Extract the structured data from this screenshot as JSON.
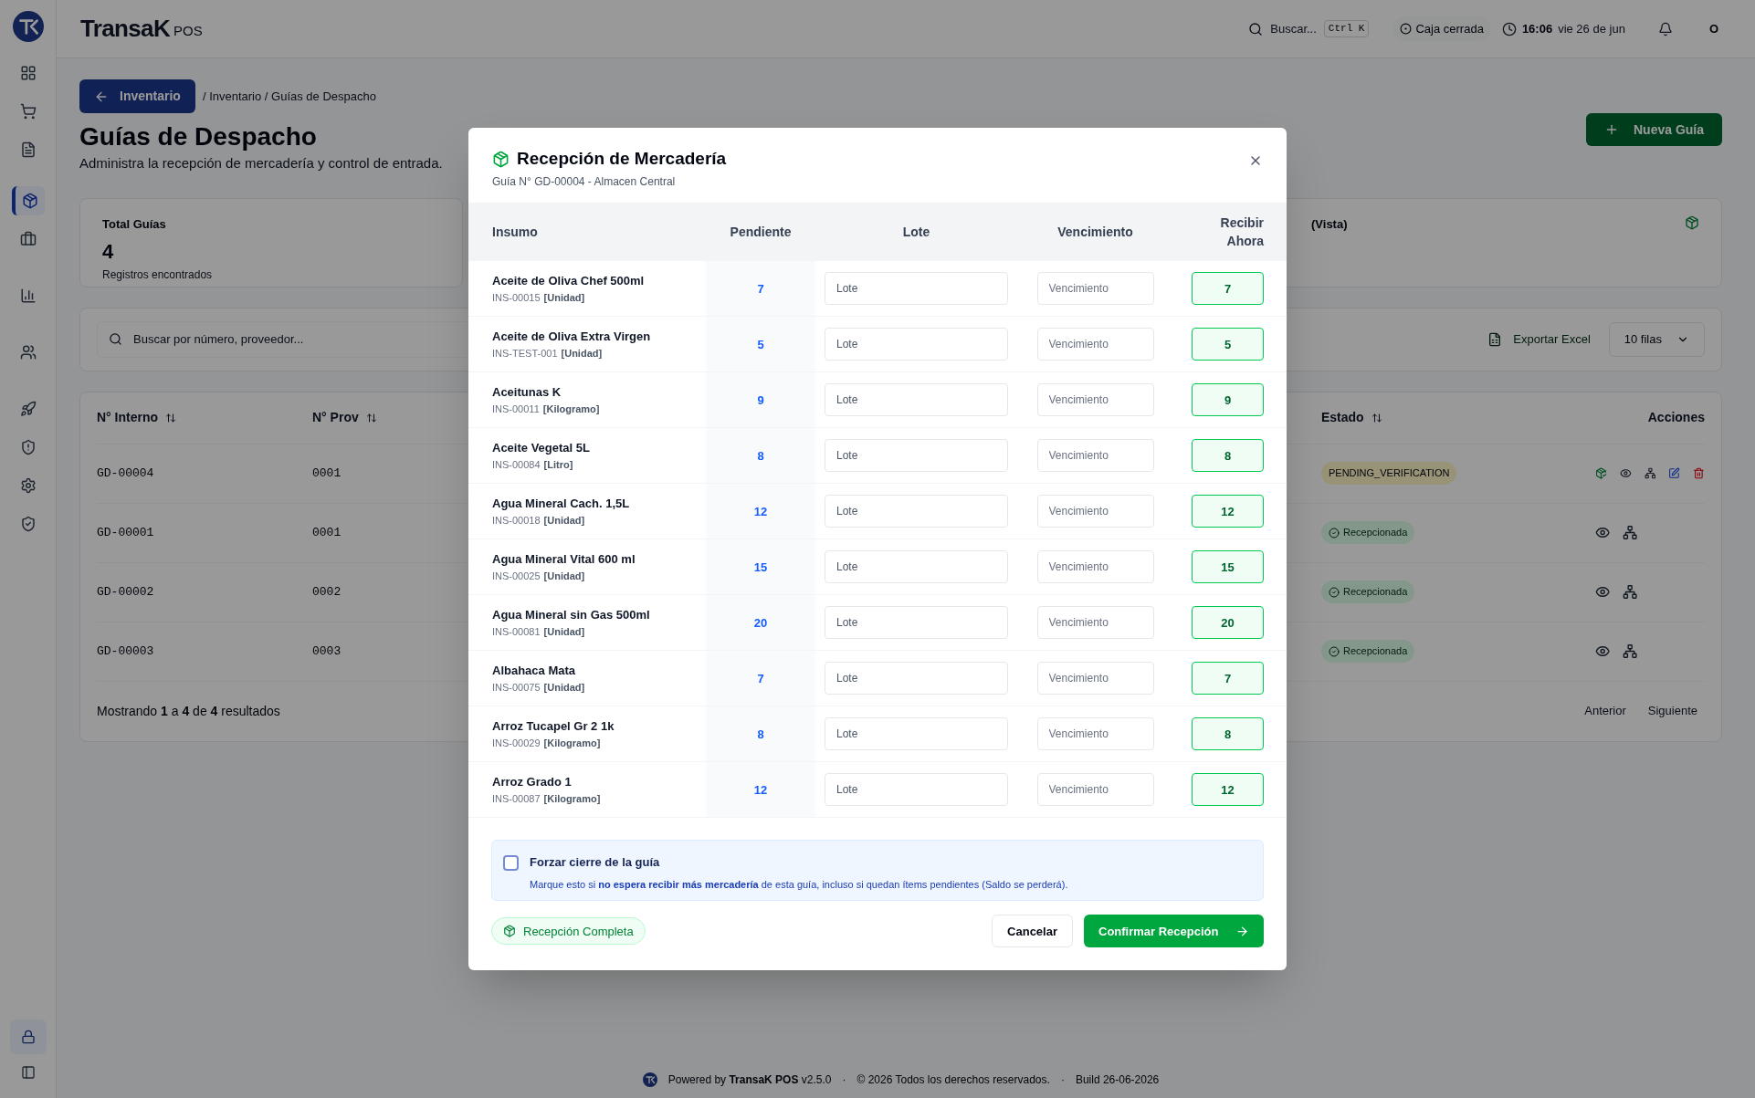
{
  "topbar": {
    "brand": "TransaK",
    "brand_suffix": "POS",
    "search": "Buscar...",
    "shortcut": "Ctrl K",
    "cash_status": "Caja cerrada",
    "time": "16:06",
    "date": "vie 26 de jun",
    "avatar": "O"
  },
  "sidebar": {
    "items": [
      {
        "selected": false
      },
      {
        "selected": false
      },
      {
        "selected": false
      },
      {
        "selected": true
      },
      {
        "selected": false
      },
      {
        "selected": false
      },
      {
        "selected": false
      },
      {
        "selected": false
      },
      {
        "selected": false
      },
      {
        "selected": false
      },
      {
        "selected": false
      }
    ]
  },
  "page": {
    "back_button": "Inventario",
    "breadcrumb": "/ Inventario / Guías de Despacho",
    "title": "Guías de Despacho",
    "subtitle": "Administra la recepción de mercadería y control de entrada.",
    "new_button": "Nueva Guía",
    "stats": [
      {
        "label": "Total Guías",
        "value": "4",
        "caption": "Registros encontrados"
      },
      {
        "label": "(Vista)"
      }
    ],
    "search_placeholder": "Buscar por número, proveedor...",
    "export_button": "Exportar Excel",
    "rows_select": "10 filas",
    "columns": [
      "N° Interno",
      "N° Prov",
      "Estado",
      "Acciones"
    ],
    "rows": [
      {
        "id": "GD-00004",
        "prov": "0001",
        "status": "PENDING_VERIFICATION",
        "kind": "pending"
      },
      {
        "id": "GD-00001",
        "prov": "0001",
        "status": "Recepcionada",
        "kind": "received"
      },
      {
        "id": "GD-00002",
        "prov": "0002",
        "status": "Recepcionada",
        "kind": "received"
      },
      {
        "id": "GD-00003",
        "prov": "0003",
        "status": "Recepcionada",
        "kind": "received"
      }
    ],
    "pagination_text": "Mostrando **1** a **4** de **4** resultados",
    "prev": "Anterior",
    "next": "Siguiente"
  },
  "footer": {
    "powered": "Powered by **TransaK POS** v2.5.0",
    "sep1": "·",
    "copyright": "© 2026 Todos los derechos reservados.",
    "sep2": "·",
    "build": "Build 26-06-2026"
  },
  "modal": {
    "title": "Recepción de Mercadería",
    "subtitle": "Guía N° GD-00004 - Almacen Central",
    "columns": [
      "Insumo",
      "Pendiente",
      "Lote",
      "Vencimiento",
      "Recibir Ahora"
    ],
    "items": [
      {
        "name": "Aceite de Oliva Chef 500ml",
        "code": "INS-00015",
        "unit": "[Unidad]",
        "pending": "7",
        "lot_placeholder": "Lote",
        "expiry_placeholder": "Vencimiento",
        "receive": "7"
      },
      {
        "name": "Aceite de Oliva Extra Virgen",
        "code": "INS-TEST-001",
        "unit": "[Unidad]",
        "pending": "5",
        "lot_placeholder": "Lote",
        "expiry_placeholder": "Vencimiento",
        "receive": "5"
      },
      {
        "name": "Aceitunas K",
        "code": "INS-00011",
        "unit": "[Kilogramo]",
        "pending": "9",
        "lot_placeholder": "Lote",
        "expiry_placeholder": "Vencimiento",
        "receive": "9"
      },
      {
        "name": "Aceite Vegetal 5L",
        "code": "INS-00084",
        "unit": "[Litro]",
        "pending": "8",
        "lot_placeholder": "Lote",
        "expiry_placeholder": "Vencimiento",
        "receive": "8"
      },
      {
        "name": "Agua Mineral Cach. 1,5L",
        "code": "INS-00018",
        "unit": "[Unidad]",
        "pending": "12",
        "lot_placeholder": "Lote",
        "expiry_placeholder": "Vencimiento",
        "receive": "12"
      },
      {
        "name": "Agua Mineral Vital 600 ml",
        "code": "INS-00025",
        "unit": "[Unidad]",
        "pending": "15",
        "lot_placeholder": "Lote",
        "expiry_placeholder": "Vencimiento",
        "receive": "15"
      },
      {
        "name": "Agua Mineral sin Gas 500ml",
        "code": "INS-00081",
        "unit": "[Unidad]",
        "pending": "20",
        "lot_placeholder": "Lote",
        "expiry_placeholder": "Vencimiento",
        "receive": "20"
      },
      {
        "name": "Albahaca Mata",
        "code": "INS-00075",
        "unit": "[Unidad]",
        "pending": "7",
        "lot_placeholder": "Lote",
        "expiry_placeholder": "Vencimiento",
        "receive": "7"
      },
      {
        "name": "Arroz Tucapel Gr 2 1k",
        "code": "INS-00029",
        "unit": "[Kilogramo]",
        "pending": "8",
        "lot_placeholder": "Lote",
        "expiry_placeholder": "Vencimiento",
        "receive": "8"
      },
      {
        "name": "Arroz Grado 1",
        "code": "INS-00087",
        "unit": "[Kilogramo]",
        "pending": "12",
        "lot_placeholder": "Lote",
        "expiry_placeholder": "Vencimiento",
        "receive": "12"
      }
    ],
    "force_close": {
      "label": "Forzar cierre de la guía",
      "checked": false,
      "note": "Marque esto si **no espera recibir más mercadería** de esta guía, incluso si quedan ítems pendientes (Saldo se perderá)."
    },
    "complete_badge": "Recepción Completa",
    "cancel": "Cancelar",
    "confirm": "Confirmar Recepción"
  }
}
